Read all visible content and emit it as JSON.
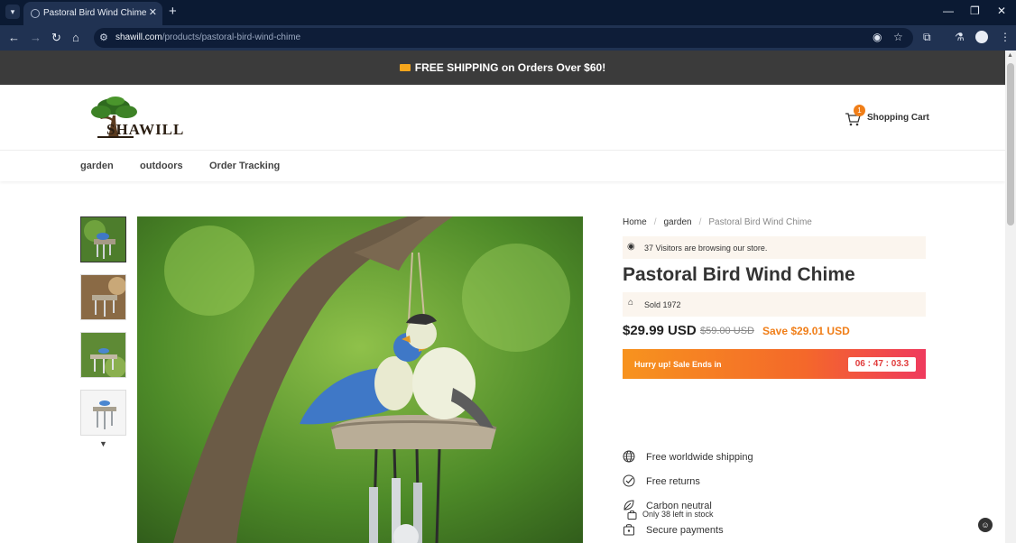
{
  "browser": {
    "tab_title": "Pastoral Bird Wind Chime",
    "url_host": "shawill.com",
    "url_path": "/products/pastoral-bird-wind-chime"
  },
  "announcement": "FREE SHIPPING on Orders Over $60!",
  "header": {
    "logo_text": "SHAWILL",
    "cart_count": "1",
    "cart_label": "Shopping Cart"
  },
  "menu": [
    {
      "label": "garden"
    },
    {
      "label": "outdoors"
    },
    {
      "label": "Order Tracking"
    }
  ],
  "breadcrumb": {
    "home": "Home",
    "category": "garden",
    "current": "Pastoral Bird Wind Chime"
  },
  "product": {
    "visitors_text": "37 Visitors are browsing our store.",
    "title": "Pastoral Bird Wind Chime",
    "sold_text": "Sold 1972",
    "price": "$29.99 USD",
    "compare_price": "$59.00 USD",
    "save_text": "Save $29.01 USD",
    "timer_label": "Hurry up! Sale Ends in",
    "timer_value": "06 : 47 : 03.3",
    "stock_text": "Only 38 left in stock"
  },
  "features": [
    {
      "label": "Free worldwide shipping",
      "icon": "globe-icon"
    },
    {
      "label": "Free returns",
      "icon": "check-circle-icon"
    },
    {
      "label": "Carbon neutral",
      "icon": "leaf-icon"
    },
    {
      "label": "Secure payments",
      "icon": "lock-bag-icon"
    }
  ],
  "colors": {
    "accent": "#f07e18",
    "timer_start": "#f7931e",
    "timer_end": "#ef3a5d",
    "info_bg": "#fbf5ee",
    "announce_bg": "#3b3b3b"
  }
}
